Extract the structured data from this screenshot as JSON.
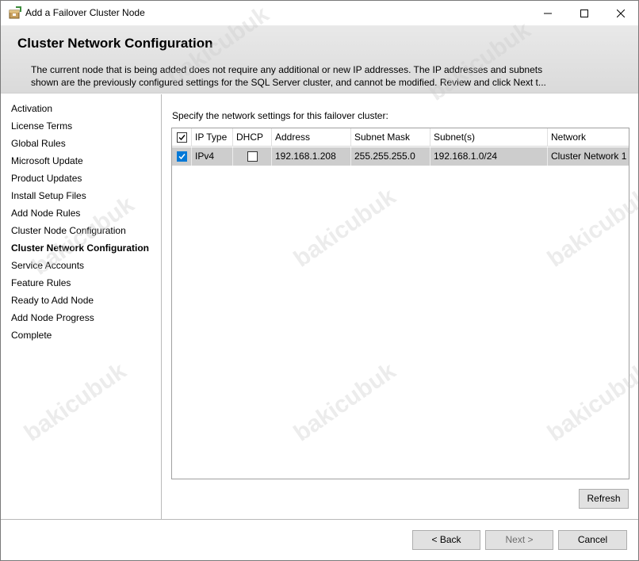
{
  "window": {
    "title": "Add a Failover Cluster Node"
  },
  "header": {
    "title": "Cluster Network Configuration",
    "desc_line1": "The current node that is being added does not require any additional or new IP addresses.  The IP addresses and subnets",
    "desc_line2": "shown are the previously configured settings for the SQL Server cluster, and cannot be modified. Review and click Next t..."
  },
  "nav": {
    "items": [
      {
        "label": "Activation"
      },
      {
        "label": "License Terms"
      },
      {
        "label": "Global Rules"
      },
      {
        "label": "Microsoft Update"
      },
      {
        "label": "Product Updates"
      },
      {
        "label": "Install Setup Files"
      },
      {
        "label": "Add Node Rules"
      },
      {
        "label": "Cluster Node Configuration"
      },
      {
        "label": "Cluster Network Configuration"
      },
      {
        "label": "Service Accounts"
      },
      {
        "label": "Feature Rules"
      },
      {
        "label": "Ready to Add Node"
      },
      {
        "label": "Add Node Progress"
      },
      {
        "label": "Complete"
      }
    ],
    "current_index": 8
  },
  "main": {
    "instruction": "Specify the network settings for this failover cluster:",
    "columns": [
      "IP Type",
      "DHCP",
      "Address",
      "Subnet Mask",
      "Subnet(s)",
      "Network"
    ],
    "rows": [
      {
        "selected": true,
        "ip_type": "IPv4",
        "dhcp": false,
        "address": "192.168.1.208",
        "subnet_mask": "255.255.255.0",
        "subnets": "192.168.1.0/24",
        "network": "Cluster Network 1"
      }
    ],
    "refresh_label": "Refresh"
  },
  "footer": {
    "back_label": "< Back",
    "next_label": "Next >",
    "cancel_label": "Cancel"
  },
  "watermark": "bakicubuk",
  "colors": {
    "accent": "#0078d7",
    "header_bg": "#e0e0e0",
    "row_selected": "#cdcdcd"
  }
}
